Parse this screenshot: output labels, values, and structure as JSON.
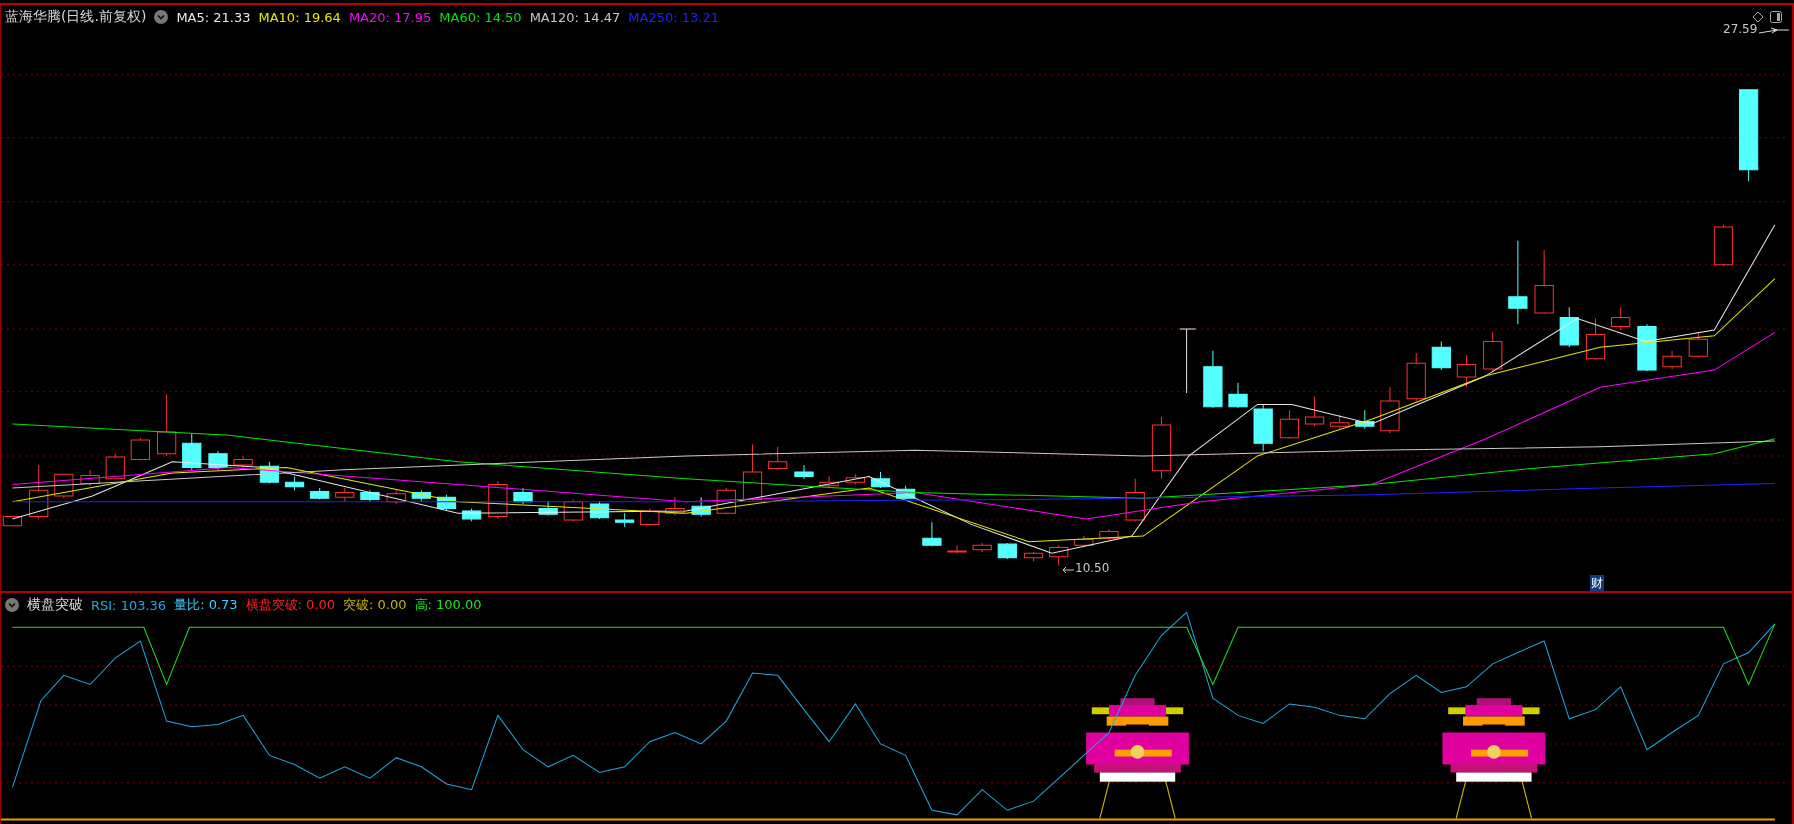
{
  "price_panel": {
    "title": "蓝海华腾(日线.前复权)",
    "ma_readings": [
      {
        "label": "MA5: 21.33",
        "color": "#e8e8e8"
      },
      {
        "label": "MA10: 19.64",
        "color": "#e8e800"
      },
      {
        "label": "MA20: 17.95",
        "color": "#ff00ff"
      },
      {
        "label": "MA60: 14.50",
        "color": "#00e800"
      },
      {
        "label": "MA120: 14.47",
        "color": "#c8c8c8"
      },
      {
        "label": "MA250: 13.21",
        "color": "#2020ff"
      }
    ],
    "high_marker": "27.59",
    "low_marker": "10.50",
    "badge": "财"
  },
  "indicator_panel": {
    "title": "横盘突破",
    "readings": [
      {
        "label": "RSI: 103.36",
        "color": "#1ea8e0"
      },
      {
        "label": "量比: 0.73",
        "color": "#40d0ff"
      },
      {
        "label": "横盘突破: 0.00",
        "color": "#ff2020"
      },
      {
        "label": "突破: 0.00",
        "color": "#c8b400"
      },
      {
        "label": "高: 100.00",
        "color": "#20e020"
      }
    ]
  }
}
